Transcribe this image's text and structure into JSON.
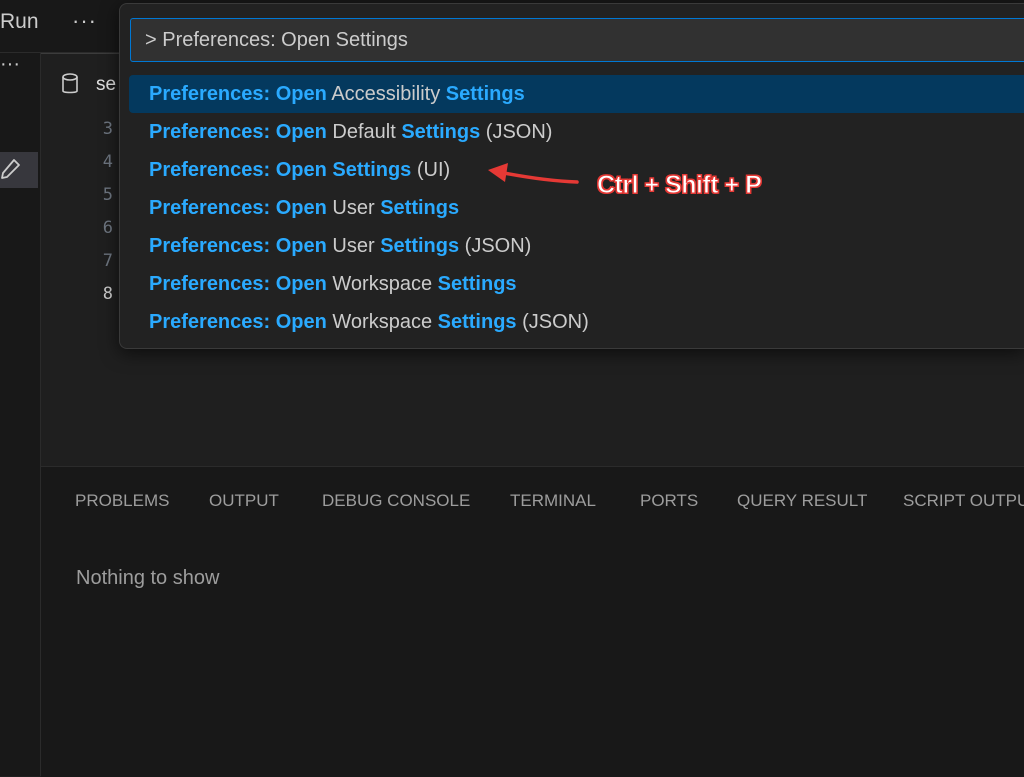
{
  "titlebar": {
    "run_menu": "Run",
    "more_label": "···"
  },
  "activitybar": {
    "more_label": "···"
  },
  "editor": {
    "tab": {
      "label": "se"
    },
    "line_numbers": [
      "3",
      "4",
      "5",
      "6",
      "7",
      "8"
    ],
    "active_line": "8"
  },
  "command_palette": {
    "input_value": "> Preferences: Open Settings",
    "items": [
      {
        "parts": [
          {
            "t": "Preferences: Open",
            "h": true
          },
          {
            "t": " Accessibility ",
            "h": false
          },
          {
            "t": "Settings",
            "h": true
          }
        ]
      },
      {
        "parts": [
          {
            "t": "Preferences: Open",
            "h": true
          },
          {
            "t": " Default ",
            "h": false
          },
          {
            "t": "Settings",
            "h": true
          },
          {
            "t": " (JSON)",
            "h": false
          }
        ]
      },
      {
        "parts": [
          {
            "t": "Preferences: Open Settings",
            "h": true
          },
          {
            "t": " (UI)",
            "h": false
          }
        ]
      },
      {
        "parts": [
          {
            "t": "Preferences: Open",
            "h": true
          },
          {
            "t": " User ",
            "h": false
          },
          {
            "t": "Settings",
            "h": true
          }
        ]
      },
      {
        "parts": [
          {
            "t": "Preferences: Open",
            "h": true
          },
          {
            "t": " User ",
            "h": false
          },
          {
            "t": "Settings",
            "h": true
          },
          {
            "t": " (JSON)",
            "h": false
          }
        ]
      },
      {
        "parts": [
          {
            "t": "Preferences: Open",
            "h": true
          },
          {
            "t": " Workspace ",
            "h": false
          },
          {
            "t": "Settings",
            "h": true
          }
        ]
      },
      {
        "parts": [
          {
            "t": "Preferences: Open",
            "h": true
          },
          {
            "t": " Workspace ",
            "h": false
          },
          {
            "t": "Settings",
            "h": true
          },
          {
            "t": " (JSON)",
            "h": false
          }
        ]
      }
    ],
    "selected_index": 0
  },
  "annotation": {
    "label": "Ctrl + Shift + P",
    "color": "#e53935"
  },
  "panel": {
    "tabs": [
      "PROBLEMS",
      "OUTPUT",
      "DEBUG CONSOLE",
      "TERMINAL",
      "PORTS",
      "QUERY RESULT",
      "SCRIPT OUTPUT"
    ],
    "empty_message": "Nothing to show"
  },
  "colors": {
    "highlight": "#2aaaff",
    "selection": "#04395e",
    "focus_border": "#0078d4",
    "background": "#1f1f1f"
  },
  "icons": [
    "database-icon",
    "pencil-icon",
    "more-icon"
  ]
}
